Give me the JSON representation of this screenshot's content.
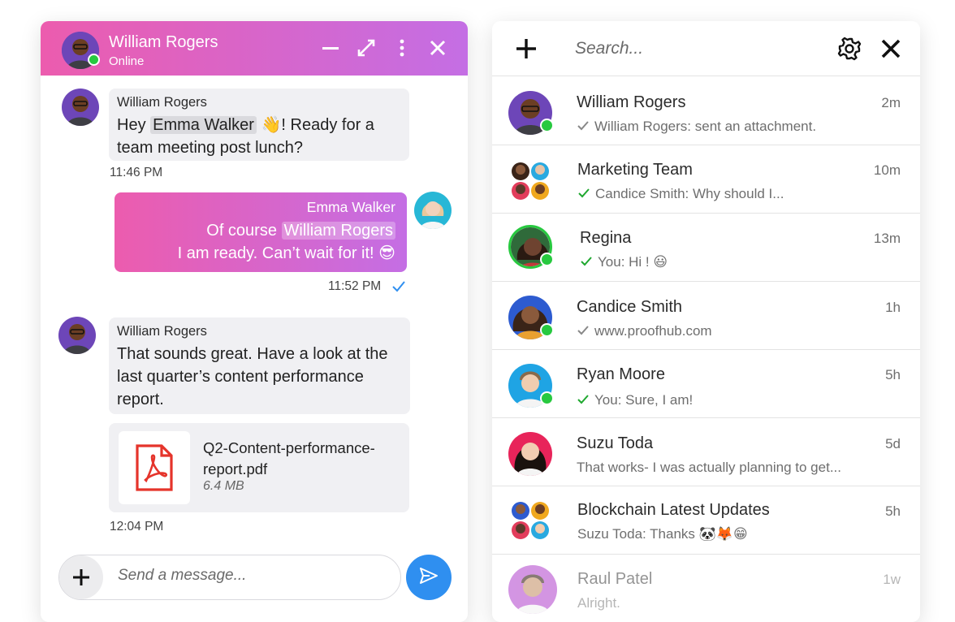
{
  "chat": {
    "header": {
      "name": "William Rogers",
      "status": "Online"
    },
    "messages": [
      {
        "sender": "William Rogers",
        "pre": "Hey ",
        "mention": "Emma Walker",
        "post": " 👋! Ready for a team meeting post lunch?",
        "time": "11:46 PM"
      },
      {
        "sender": "Emma Walker",
        "pre": "Of course ",
        "mention": "William Rogers",
        "line2": "I am ready. Can’t wait for it! 😎",
        "time": "11:52 PM"
      },
      {
        "sender": "William Rogers",
        "text": "That sounds great. Have a look at the last quarter’s content performance report.",
        "time": "12:04 PM"
      }
    ],
    "attachment": {
      "name": "Q2-Content-performance-report.pdf",
      "size": "6.4 MB"
    },
    "composer": {
      "placeholder": "Send a message..."
    }
  },
  "list": {
    "search_placeholder": "Search...",
    "conversations": [
      {
        "name": "William Rogers",
        "preview": "William Rogers: sent an attachment.",
        "time": "2m",
        "check": "grey"
      },
      {
        "name": "Marketing Team",
        "preview": "Candice Smith: Why should I...",
        "time": "10m",
        "check": "green"
      },
      {
        "name": "Regina",
        "preview": "You: Hi ! 😃",
        "time": "13m",
        "check": "green"
      },
      {
        "name": "Candice Smith",
        "preview": "www.proofhub.com",
        "time": "1h",
        "check": "grey"
      },
      {
        "name": "Ryan Moore",
        "preview": "You: Sure, I am!",
        "time": "5h",
        "check": "green"
      },
      {
        "name": "Suzu Toda",
        "preview": "That works- I was actually planning to get...",
        "time": "5d",
        "check": "none"
      },
      {
        "name": "Blockchain Latest Updates",
        "preview": "Suzu Toda: Thanks 🐼🦊😁",
        "time": "5h",
        "check": "none"
      },
      {
        "name": "Raul Patel",
        "preview": "Alright.",
        "time": "1w",
        "check": "none"
      }
    ]
  },
  "colors": {
    "accent_pink": "#ec5cae",
    "accent_purple": "#c46ee4",
    "send_blue": "#2f8ff0",
    "online_green": "#27c93f",
    "check_green": "#1fa82f"
  },
  "icons": [
    "minimize-icon",
    "expand-icon",
    "more-vertical-icon",
    "close-icon",
    "plus-icon",
    "send-icon",
    "gear-icon",
    "pdf-icon",
    "check-icon"
  ]
}
